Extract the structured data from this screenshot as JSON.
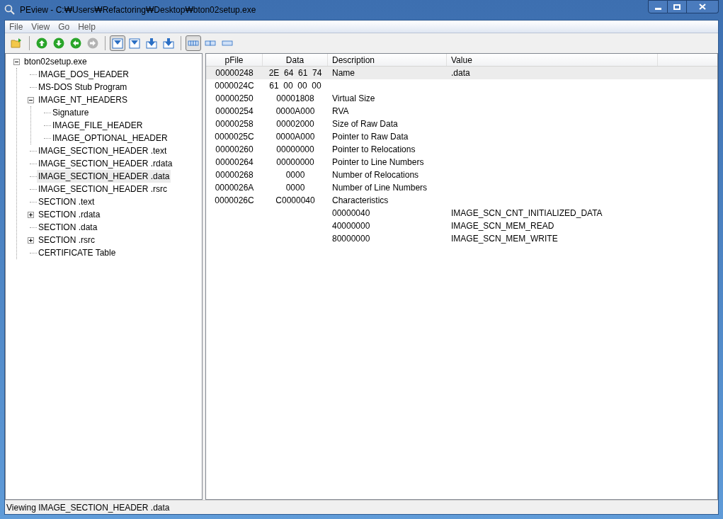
{
  "window": {
    "title": "PEview - C:₩Users₩Refactoring₩Desktop₩bton02setup.exe"
  },
  "menu": [
    "File",
    "View",
    "Go",
    "Help"
  ],
  "toolbar": [
    {
      "kind": "open",
      "pressed": false,
      "disabled": false
    },
    {
      "kind": "separator"
    },
    {
      "kind": "up",
      "pressed": false,
      "disabled": false
    },
    {
      "kind": "down",
      "pressed": false,
      "disabled": false
    },
    {
      "kind": "back",
      "pressed": false,
      "disabled": false
    },
    {
      "kind": "forward",
      "pressed": false,
      "disabled": true
    },
    {
      "kind": "separator"
    },
    {
      "kind": "byte",
      "pressed": true,
      "disabled": false
    },
    {
      "kind": "word",
      "pressed": false,
      "disabled": false
    },
    {
      "kind": "dword",
      "pressed": false,
      "disabled": false
    },
    {
      "kind": "qword",
      "pressed": false,
      "disabled": false
    },
    {
      "kind": "separator"
    },
    {
      "kind": "wide",
      "pressed": true,
      "disabled": false
    },
    {
      "kind": "medium",
      "pressed": false,
      "disabled": false
    },
    {
      "kind": "narrow",
      "pressed": false,
      "disabled": false
    }
  ],
  "tree": [
    {
      "label": "bton02setup.exe",
      "selected": false,
      "expanded": true,
      "children": [
        {
          "label": "IMAGE_DOS_HEADER",
          "selected": false
        },
        {
          "label": "MS-DOS Stub Program",
          "selected": false
        },
        {
          "label": "IMAGE_NT_HEADERS",
          "selected": false,
          "expanded": true,
          "children": [
            {
              "label": "Signature",
              "selected": false
            },
            {
              "label": "IMAGE_FILE_HEADER",
              "selected": false
            },
            {
              "label": "IMAGE_OPTIONAL_HEADER",
              "selected": false
            }
          ]
        },
        {
          "label": "IMAGE_SECTION_HEADER .text",
          "selected": false
        },
        {
          "label": "IMAGE_SECTION_HEADER .rdata",
          "selected": false
        },
        {
          "label": "IMAGE_SECTION_HEADER .data",
          "selected": true
        },
        {
          "label": "IMAGE_SECTION_HEADER .rsrc",
          "selected": false
        },
        {
          "label": "SECTION .text",
          "selected": false
        },
        {
          "label": "SECTION .rdata",
          "selected": false,
          "expanded": false
        },
        {
          "label": "SECTION .data",
          "selected": false
        },
        {
          "label": "SECTION .rsrc",
          "selected": false,
          "expanded": false
        },
        {
          "label": "CERTIFICATE Table",
          "selected": false
        }
      ]
    }
  ],
  "table": {
    "columns": [
      "pFile",
      "Data",
      "Description",
      "Value"
    ],
    "rows": [
      {
        "pfile": "00000248",
        "data": "2E  64  61  74",
        "description": "Name",
        "value": ".data",
        "selected": true
      },
      {
        "pfile": "0000024C",
        "data": "61  00  00  00",
        "selected": false
      },
      {
        "pfile": "00000250",
        "data": "00001808",
        "description": "Virtual Size",
        "selected": false
      },
      {
        "pfile": "00000254",
        "data": "0000A000",
        "description": "RVA",
        "selected": false
      },
      {
        "pfile": "00000258",
        "data": "00002000",
        "description": "Size of Raw Data",
        "selected": false
      },
      {
        "pfile": "0000025C",
        "data": "0000A000",
        "description": "Pointer to Raw Data",
        "selected": false
      },
      {
        "pfile": "00000260",
        "data": "00000000",
        "description": "Pointer to Relocations",
        "selected": false
      },
      {
        "pfile": "00000264",
        "data": "00000000",
        "description": "Pointer to Line Numbers",
        "selected": false
      },
      {
        "pfile": "00000268",
        "data": "0000",
        "description": "Number of Relocations",
        "selected": false
      },
      {
        "pfile": "0000026A",
        "data": "0000",
        "description": "Number of Line Numbers",
        "selected": false
      },
      {
        "pfile": "0000026C",
        "data": "C0000040",
        "description": "Characteristics",
        "selected": false
      },
      {
        "description": "00000040",
        "value": "IMAGE_SCN_CNT_INITIALIZED_DATA",
        "selected": false
      },
      {
        "description": "40000000",
        "value": "IMAGE_SCN_MEM_READ",
        "selected": false
      },
      {
        "description": "80000000",
        "value": "IMAGE_SCN_MEM_WRITE",
        "selected": false
      }
    ]
  },
  "status_bar": "Viewing IMAGE_SECTION_HEADER .data"
}
